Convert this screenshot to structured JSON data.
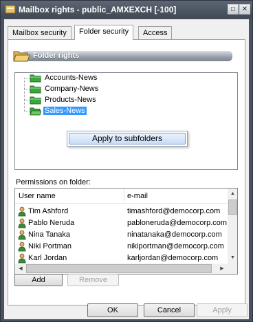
{
  "window": {
    "title": "Mailbox rights - public_AMXEXCH [-100]",
    "maximize_glyph": "□",
    "close_glyph": "✕"
  },
  "tabs": [
    {
      "label": "Mailbox security",
      "active": false
    },
    {
      "label": "Folder security",
      "active": true
    },
    {
      "label": "Access",
      "active": false
    }
  ],
  "folder_rights": {
    "title": "Folder rights",
    "icon": "folder-open-icon"
  },
  "tree": {
    "items": [
      {
        "label": "Accounts-News",
        "selected": false
      },
      {
        "label": "Company-News",
        "selected": false
      },
      {
        "label": "Products-News",
        "selected": false
      },
      {
        "label": "Sales-News",
        "selected": true
      }
    ]
  },
  "context_menu": {
    "items": [
      {
        "label": "Apply to subfolders"
      }
    ]
  },
  "permissions": {
    "label": "Permissions on folder:",
    "columns": [
      "User name",
      "e-mail"
    ],
    "rows": [
      {
        "name": "Tim Ashford",
        "email": "timashford@democorp.com"
      },
      {
        "name": "Pablo Neruda",
        "email": "pabloneruda@democorp.com"
      },
      {
        "name": "Nina Tanaka",
        "email": "ninatanaka@democorp.com"
      },
      {
        "name": "Niki Portman",
        "email": "nikiportman@democorp.com"
      },
      {
        "name": "Karl Jordan",
        "email": "karljordan@democorp.com"
      }
    ]
  },
  "buttons": {
    "add": "Add",
    "remove": "Remove",
    "ok": "OK",
    "cancel": "Cancel",
    "apply": "Apply"
  },
  "colors": {
    "selection": "#3399ff",
    "titlebar": "#4a5460",
    "folder": "#3aa83a"
  }
}
